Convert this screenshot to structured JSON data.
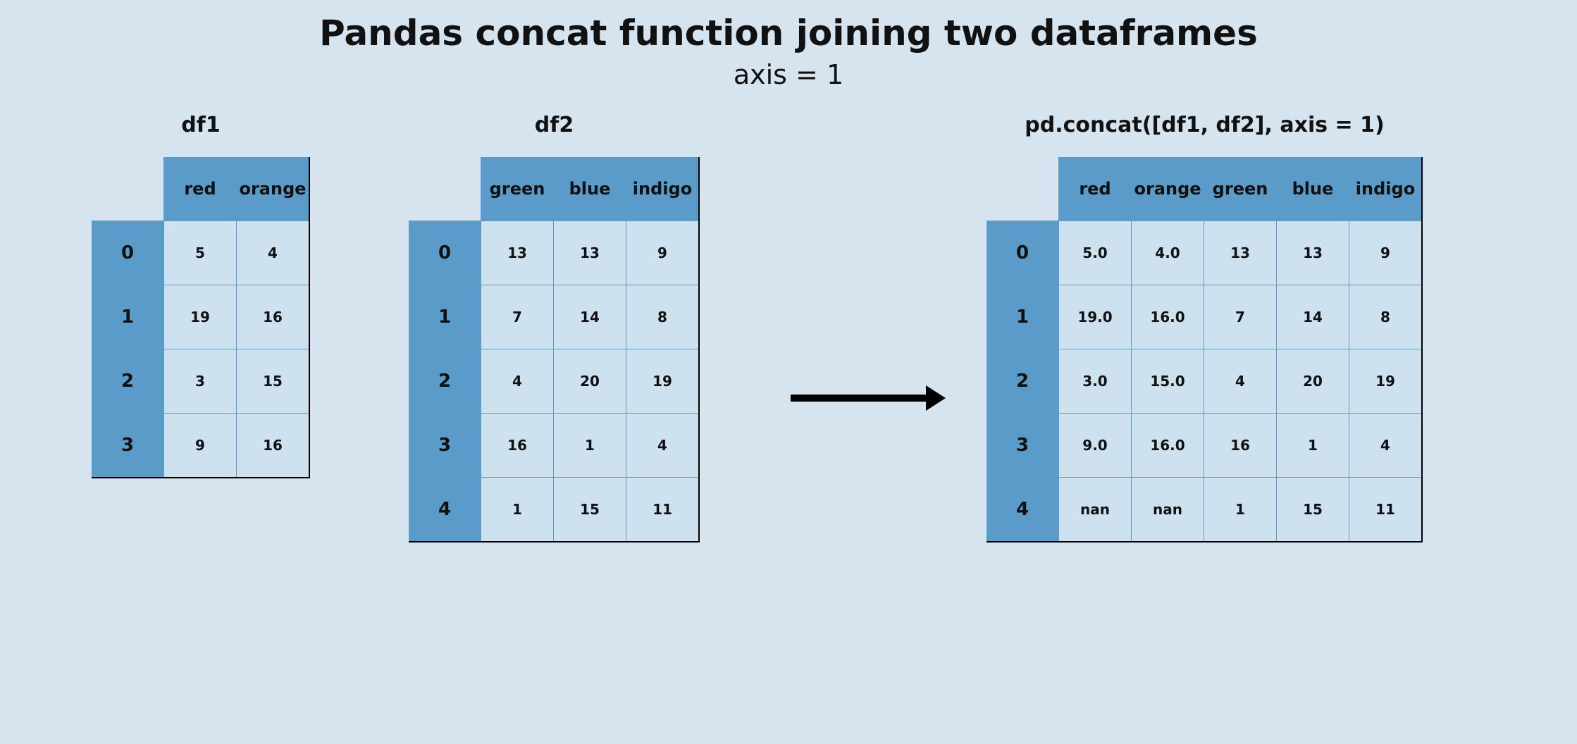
{
  "title": "Pandas concat function joining two dataframes",
  "subtitle": "axis = 1",
  "tables": {
    "df1": {
      "caption": "df1",
      "columns": [
        "red",
        "orange"
      ],
      "index": [
        "0",
        "1",
        "2",
        "3"
      ],
      "data": [
        [
          "5",
          "4"
        ],
        [
          "19",
          "16"
        ],
        [
          "3",
          "15"
        ],
        [
          "9",
          "16"
        ]
      ]
    },
    "df2": {
      "caption": "df2",
      "columns": [
        "green",
        "blue",
        "indigo"
      ],
      "index": [
        "0",
        "1",
        "2",
        "3",
        "4"
      ],
      "data": [
        [
          "13",
          "13",
          "9"
        ],
        [
          "7",
          "14",
          "8"
        ],
        [
          "4",
          "20",
          "19"
        ],
        [
          "16",
          "1",
          "4"
        ],
        [
          "1",
          "15",
          "11"
        ]
      ]
    },
    "result": {
      "caption": "pd.concat([df1, df2], axis = 1)",
      "columns": [
        "red",
        "orange",
        "green",
        "blue",
        "indigo"
      ],
      "index": [
        "0",
        "1",
        "2",
        "3",
        "4"
      ],
      "data": [
        [
          "5.0",
          "4.0",
          "13",
          "13",
          "9"
        ],
        [
          "19.0",
          "16.0",
          "7",
          "14",
          "8"
        ],
        [
          "3.0",
          "15.0",
          "4",
          "20",
          "19"
        ],
        [
          "9.0",
          "16.0",
          "16",
          "1",
          "4"
        ],
        [
          "nan",
          "nan",
          "1",
          "15",
          "11"
        ]
      ]
    }
  },
  "chart_data": [
    {
      "type": "table",
      "name": "df1",
      "columns": [
        "red",
        "orange"
      ],
      "index": [
        0,
        1,
        2,
        3
      ],
      "values": [
        [
          5,
          4
        ],
        [
          19,
          16
        ],
        [
          3,
          15
        ],
        [
          9,
          16
        ]
      ]
    },
    {
      "type": "table",
      "name": "df2",
      "columns": [
        "green",
        "blue",
        "indigo"
      ],
      "index": [
        0,
        1,
        2,
        3,
        4
      ],
      "values": [
        [
          13,
          13,
          9
        ],
        [
          7,
          14,
          8
        ],
        [
          4,
          20,
          19
        ],
        [
          16,
          1,
          4
        ],
        [
          1,
          15,
          11
        ]
      ]
    },
    {
      "type": "table",
      "name": "pd.concat([df1, df2], axis = 1)",
      "columns": [
        "red",
        "orange",
        "green",
        "blue",
        "indigo"
      ],
      "index": [
        0,
        1,
        2,
        3,
        4
      ],
      "values": [
        [
          5.0,
          4.0,
          13,
          13,
          9
        ],
        [
          19.0,
          16.0,
          7,
          14,
          8
        ],
        [
          3.0,
          15.0,
          4,
          20,
          19
        ],
        [
          9.0,
          16.0,
          16,
          1,
          4
        ],
        [
          null,
          null,
          1,
          15,
          11
        ]
      ]
    }
  ]
}
